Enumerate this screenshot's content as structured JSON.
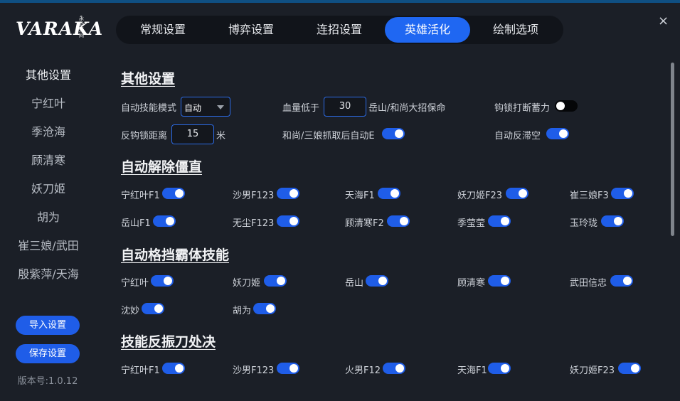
{
  "app": {
    "logo": "VARAKA",
    "logo_sub": "永劫无间"
  },
  "tabs": [
    {
      "label": "常规设置",
      "active": false
    },
    {
      "label": "博弈设置",
      "active": false
    },
    {
      "label": "连招设置",
      "active": false
    },
    {
      "label": "英雄活化",
      "active": true
    },
    {
      "label": "绘制选项",
      "active": false
    }
  ],
  "close_label": "×",
  "sidebar": {
    "items": [
      {
        "label": "其他设置",
        "active": true
      },
      {
        "label": "宁红叶",
        "active": false
      },
      {
        "label": "季沧海",
        "active": false
      },
      {
        "label": "顾清寒",
        "active": false
      },
      {
        "label": "妖刀姬",
        "active": false
      },
      {
        "label": "胡为",
        "active": false
      },
      {
        "label": "崔三娘/武田",
        "active": false
      },
      {
        "label": "殷紫萍/天海",
        "active": false
      }
    ],
    "import_label": "导入设置",
    "save_label": "保存设置",
    "version": "版本号:1.0.12"
  },
  "other": {
    "title": "其他设置",
    "auto_mode_label": "自动技能模式",
    "auto_mode_value": "自动",
    "hp_label": "血量低于",
    "hp_value": "30",
    "hp_suffix": "岳山/和尚大招保命",
    "hook_interrupt_label": "钩锁打断蓄力",
    "hook_interrupt_on": false,
    "anti_hook_label": "反钩锁距离",
    "anti_hook_value": "15",
    "anti_hook_unit": "米",
    "grab_label": "和尚/三娘抓取后自动E",
    "grab_on": true,
    "anti_stall_label": "自动反滞空",
    "anti_stall_on": true
  },
  "stiff": {
    "title": "自动解除僵直",
    "items": [
      {
        "label": "宁红叶F1",
        "on": true
      },
      {
        "label": "沙男F123",
        "on": true
      },
      {
        "label": "天海F1",
        "on": true
      },
      {
        "label": "妖刀姬F23",
        "on": true
      },
      {
        "label": "崔三娘F3",
        "on": true
      },
      {
        "label": "岳山F1",
        "on": true
      },
      {
        "label": "无尘F123",
        "on": true
      },
      {
        "label": "顾清寒F2",
        "on": true
      },
      {
        "label": "季莹莹",
        "on": true
      },
      {
        "label": "玉玲珑",
        "on": true
      }
    ]
  },
  "parry": {
    "title": "自动格挡霸体技能",
    "items": [
      {
        "label": "宁红叶",
        "on": true
      },
      {
        "label": "妖刀姬",
        "on": true
      },
      {
        "label": "岳山",
        "on": true
      },
      {
        "label": "顾清寒",
        "on": true
      },
      {
        "label": "武田信忠",
        "on": true
      },
      {
        "label": "沈妙",
        "on": true
      },
      {
        "label": "胡为",
        "on": true
      }
    ]
  },
  "counter": {
    "title": "技能反振刀处决",
    "items": [
      {
        "label": "宁红叶F1",
        "on": true
      },
      {
        "label": "沙男F123",
        "on": true
      },
      {
        "label": "火男F12",
        "on": true
      },
      {
        "label": "天海F1",
        "on": true
      },
      {
        "label": "妖刀姬F23",
        "on": true
      }
    ]
  }
}
